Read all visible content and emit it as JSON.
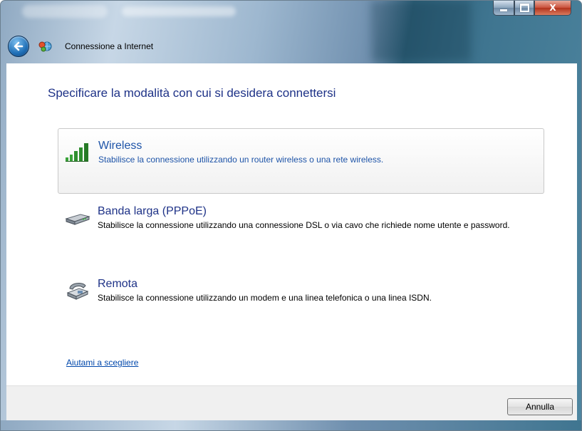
{
  "window": {
    "title": "Connessione a Internet",
    "controls": {
      "minimize": "minimize",
      "maximize": "maximize",
      "close": "X"
    }
  },
  "heading": "Specificare la modalità con cui si desidera connettersi",
  "options": [
    {
      "title": "Wireless",
      "description": "Stabilisce la connessione utilizzando un router wireless o una rete wireless.",
      "icon": "wireless-signal-icon",
      "selected": true
    },
    {
      "title": "Banda larga (PPPoE)",
      "description": "Stabilisce la connessione utilizzando una connessione DSL o via cavo che richiede nome utente e password.",
      "icon": "broadband-modem-icon",
      "selected": false
    },
    {
      "title": "Remota",
      "description": "Stabilisce la connessione utilizzando un modem e una linea telefonica o una linea ISDN.",
      "icon": "dialup-phone-icon",
      "selected": false
    }
  ],
  "help_link": "Aiutami a scegliere",
  "footer": {
    "cancel_label": "Annulla"
  },
  "colors": {
    "heading": "#1e3287",
    "selected_text": "#1e54a8",
    "link": "#0047ab",
    "close_button": "#c9503a"
  }
}
